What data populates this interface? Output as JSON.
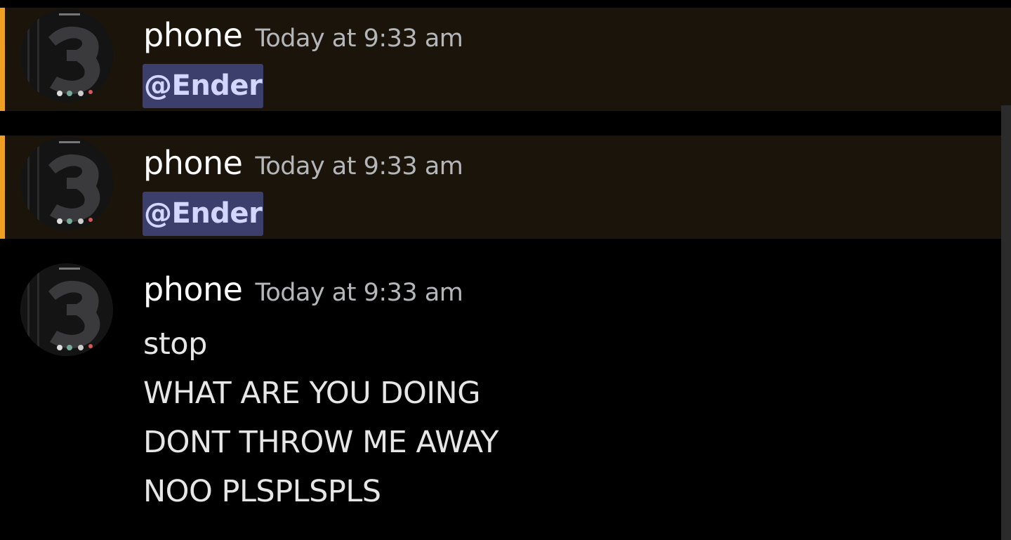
{
  "colors": {
    "background": "#000000",
    "mention_highlight": "#1b140b",
    "mention_bar": "#f0a020",
    "mention_pill_bg": "#3c3f6b",
    "mention_pill_text": "#d3d7ff",
    "username": "#ffffff",
    "timestamp": "#b4b6b9"
  },
  "messages": [
    {
      "username": "phone",
      "timestamp": "Today at 9:33 am",
      "mention": "@Ender",
      "mentioned": true
    },
    {
      "username": "phone",
      "timestamp": "Today at 9:33 am",
      "mention": "@Ender",
      "mentioned": true
    },
    {
      "username": "phone",
      "timestamp": "Today at 9:33 am",
      "mentioned": false,
      "lines": [
        "stop",
        "WHAT ARE YOU DOING",
        "DONT THROW ME AWAY",
        "NOO PLSPLSPLS"
      ]
    }
  ]
}
